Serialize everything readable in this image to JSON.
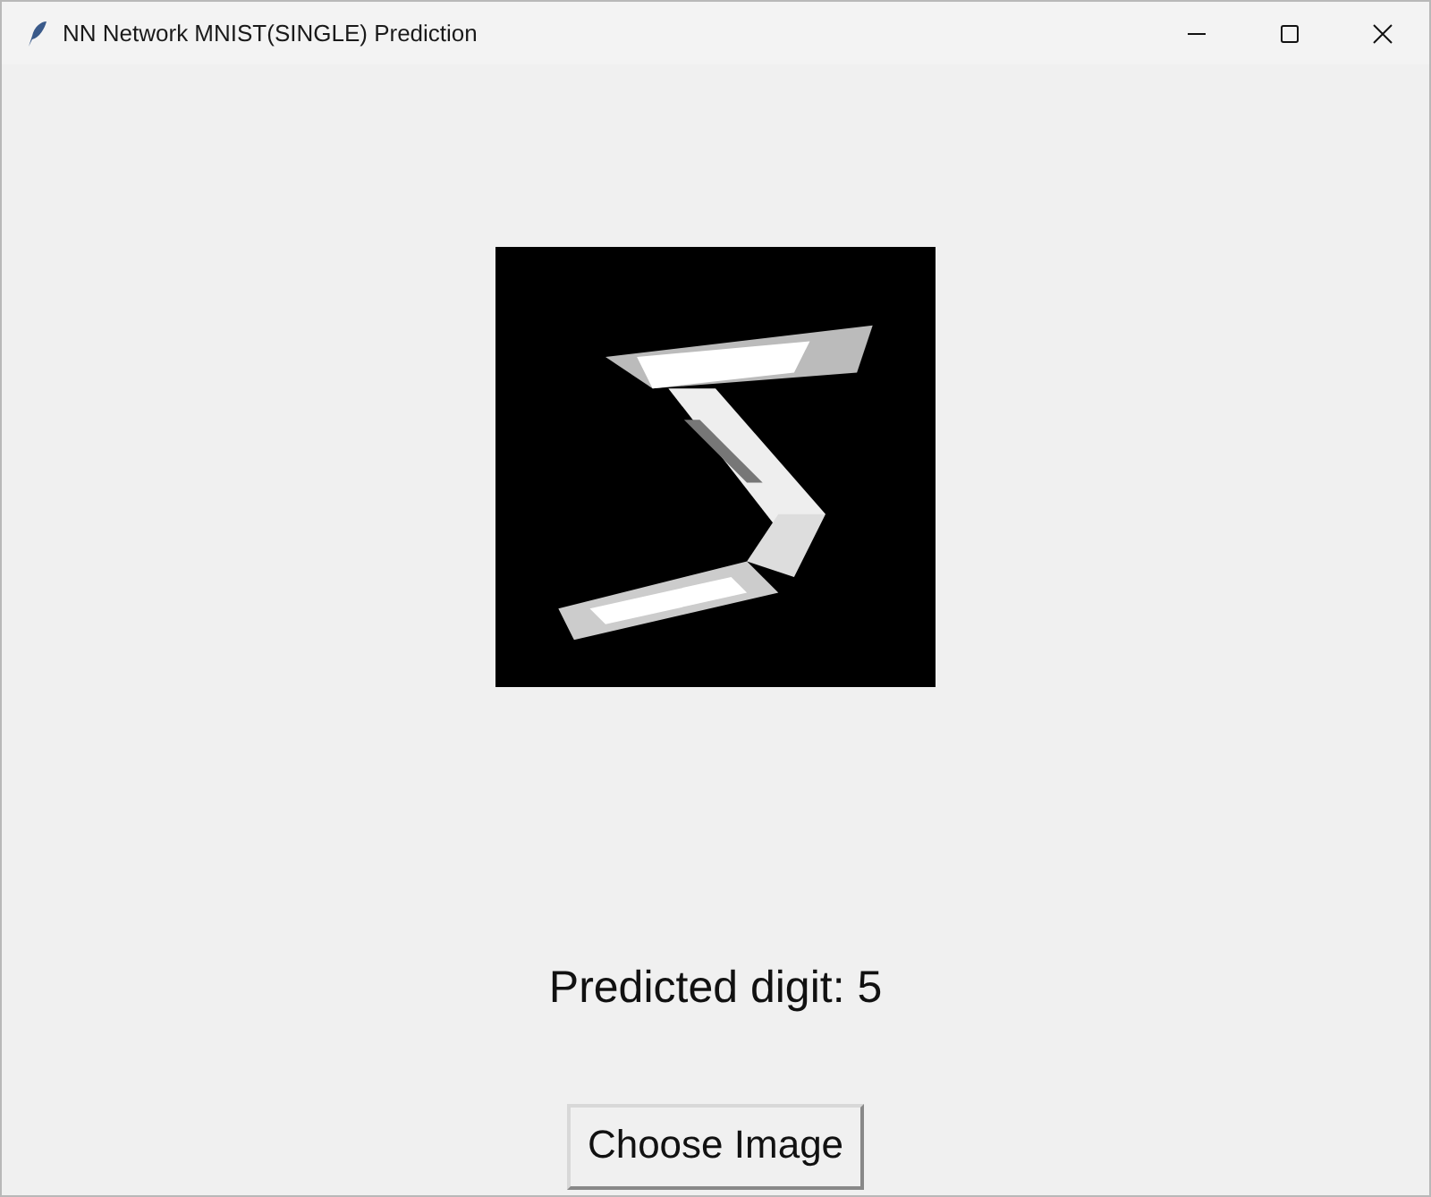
{
  "window": {
    "title": "NN Network MNIST(SINGLE) Prediction"
  },
  "prediction": "Predicted digit: 5",
  "buttons": [
    "Choose Image"
  ]
}
